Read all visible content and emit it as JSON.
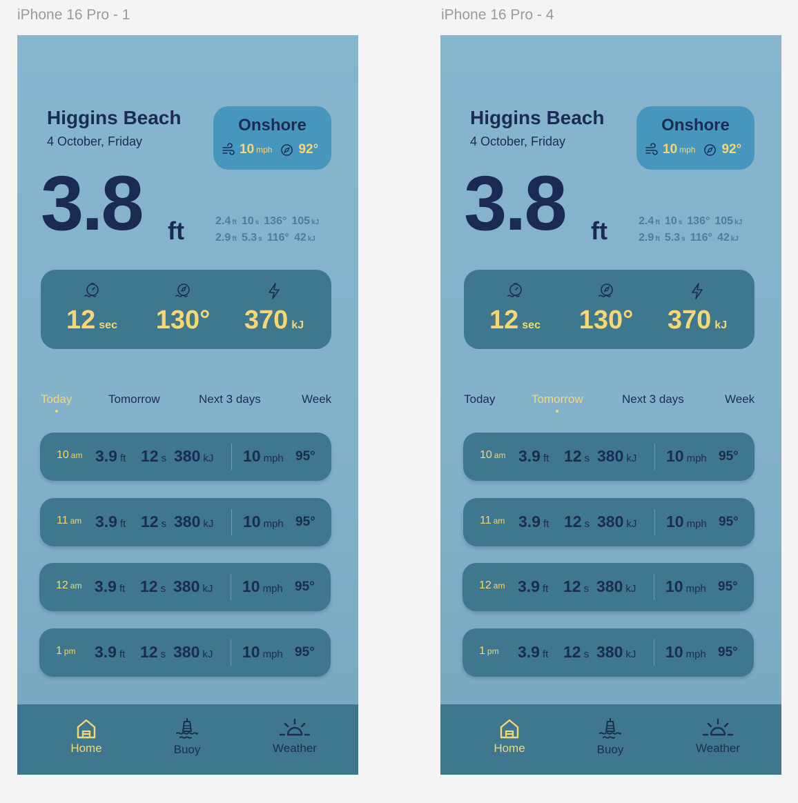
{
  "frames": [
    {
      "label": "iPhone 16 Pro - 1",
      "beach": "Higgins Beach",
      "date": "4 October, Friday",
      "onshore": {
        "title": "Onshore",
        "wind_speed": "10",
        "wind_unit": "mph",
        "direction": "92°"
      },
      "height": {
        "value": "3.8",
        "unit": "ft"
      },
      "swells": [
        {
          "h": "2.4",
          "h_unit": "ft",
          "p": "10",
          "p_unit": "s",
          "dir": "136°",
          "energy": "105",
          "energy_unit": "kJ"
        },
        {
          "h": "2.9",
          "h_unit": "ft",
          "p": "5.3",
          "p_unit": "s",
          "dir": "116°",
          "energy": "42",
          "energy_unit": "kJ"
        }
      ],
      "stats": {
        "period": {
          "value": "12",
          "unit": "sec"
        },
        "direction": {
          "value": "130°"
        },
        "energy": {
          "value": "370",
          "unit": "kJ"
        }
      },
      "tabs": [
        "Today",
        "Tomorrow",
        "Next 3 days",
        "Week"
      ],
      "active_tab": "Today",
      "forecast": [
        {
          "time": "10",
          "ampm": "am",
          "height": "3.9",
          "h_unit": "ft",
          "period": "12",
          "p_unit": "s",
          "energy": "380",
          "e_unit": "kJ",
          "wind": "10",
          "w_unit": "mph",
          "dir": "95°"
        },
        {
          "time": "11",
          "ampm": "am",
          "height": "3.9",
          "h_unit": "ft",
          "period": "12",
          "p_unit": "s",
          "energy": "380",
          "e_unit": "kJ",
          "wind": "10",
          "w_unit": "mph",
          "dir": "95°"
        },
        {
          "time": "12",
          "ampm": "am",
          "height": "3.9",
          "h_unit": "ft",
          "period": "12",
          "p_unit": "s",
          "energy": "380",
          "e_unit": "kJ",
          "wind": "10",
          "w_unit": "mph",
          "dir": "95°"
        },
        {
          "time": "1",
          "ampm": "pm",
          "height": "3.9",
          "h_unit": "ft",
          "period": "12",
          "p_unit": "s",
          "energy": "380",
          "e_unit": "kJ",
          "wind": "10",
          "w_unit": "mph",
          "dir": "95°"
        }
      ],
      "nav": [
        {
          "label": "Home",
          "icon": "home-icon",
          "active": true
        },
        {
          "label": "Buoy",
          "icon": "buoy-icon",
          "active": false
        },
        {
          "label": "Weather",
          "icon": "sunrise-icon",
          "active": false
        }
      ]
    },
    {
      "label": "iPhone 16 Pro - 4",
      "beach": "Higgins Beach",
      "date": "4 October, Friday",
      "onshore": {
        "title": "Onshore",
        "wind_speed": "10",
        "wind_unit": "mph",
        "direction": "92°"
      },
      "height": {
        "value": "3.8",
        "unit": "ft"
      },
      "swells": [
        {
          "h": "2.4",
          "h_unit": "ft",
          "p": "10",
          "p_unit": "s",
          "dir": "136°",
          "energy": "105",
          "energy_unit": "kJ"
        },
        {
          "h": "2.9",
          "h_unit": "ft",
          "p": "5.3",
          "p_unit": "s",
          "dir": "116°",
          "energy": "42",
          "energy_unit": "kJ"
        }
      ],
      "stats": {
        "period": {
          "value": "12",
          "unit": "sec"
        },
        "direction": {
          "value": "130°"
        },
        "energy": {
          "value": "370",
          "unit": "kJ"
        }
      },
      "tabs": [
        "Today",
        "Tomorrow",
        "Next 3 days",
        "Week"
      ],
      "active_tab": "Tomorrow",
      "forecast": [
        {
          "time": "10",
          "ampm": "am",
          "height": "3.9",
          "h_unit": "ft",
          "period": "12",
          "p_unit": "s",
          "energy": "380",
          "e_unit": "kJ",
          "wind": "10",
          "w_unit": "mph",
          "dir": "95°"
        },
        {
          "time": "11",
          "ampm": "am",
          "height": "3.9",
          "h_unit": "ft",
          "period": "12",
          "p_unit": "s",
          "energy": "380",
          "e_unit": "kJ",
          "wind": "10",
          "w_unit": "mph",
          "dir": "95°"
        },
        {
          "time": "12",
          "ampm": "am",
          "height": "3.9",
          "h_unit": "ft",
          "period": "12",
          "p_unit": "s",
          "energy": "380",
          "e_unit": "kJ",
          "wind": "10",
          "w_unit": "mph",
          "dir": "95°"
        },
        {
          "time": "1",
          "ampm": "pm",
          "height": "3.9",
          "h_unit": "ft",
          "period": "12",
          "p_unit": "s",
          "energy": "380",
          "e_unit": "kJ",
          "wind": "10",
          "w_unit": "mph",
          "dir": "95°"
        }
      ],
      "nav": [
        {
          "label": "Home",
          "icon": "home-icon",
          "active": true
        },
        {
          "label": "Buoy",
          "icon": "buoy-icon",
          "active": false
        },
        {
          "label": "Weather",
          "icon": "sunrise-icon",
          "active": false
        }
      ]
    }
  ],
  "colors": {
    "accent": "#f7d774",
    "ink": "#1c2b55",
    "card": "#3f778f",
    "badge": "#4796bd",
    "bg": "#86b5ce"
  }
}
